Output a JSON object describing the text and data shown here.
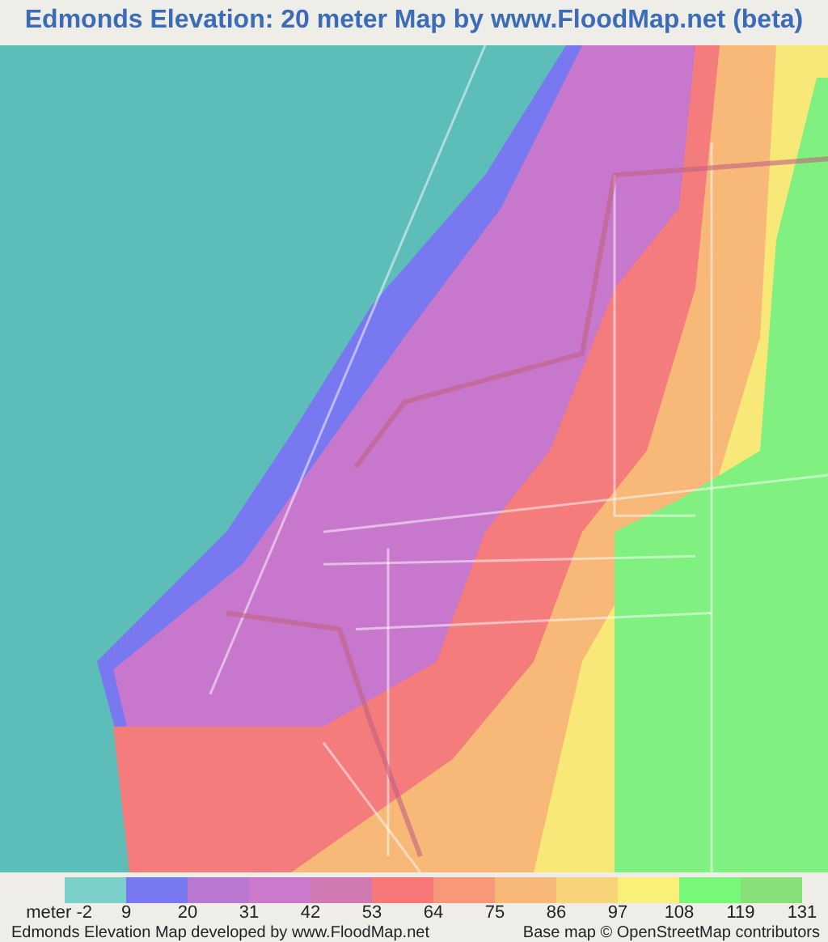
{
  "title": "Edmonds Elevation: 20 meter Map by www.FloodMap.net (beta)",
  "legend": {
    "unit": "meter",
    "items": [
      {
        "label": "-2",
        "color": "#7acfc8"
      },
      {
        "label": "9",
        "color": "#7878f0"
      },
      {
        "label": "20",
        "color": "#b878d0"
      },
      {
        "label": "31",
        "color": "#cc7acc"
      },
      {
        "label": "42",
        "color": "#d078b0"
      },
      {
        "label": "53",
        "color": "#f87878"
      },
      {
        "label": "64",
        "color": "#f89878"
      },
      {
        "label": "75",
        "color": "#f8b878"
      },
      {
        "label": "86",
        "color": "#f8d478"
      },
      {
        "label": "97",
        "color": "#f8f078"
      },
      {
        "label": "108",
        "color": "#78f878"
      },
      {
        "label": "119",
        "color": "#88e078"
      }
    ],
    "last_label": "131"
  },
  "footer": {
    "left": "Edmonds Elevation Map developed by www.FloodMap.net",
    "right": "Base map © OpenStreetMap contributors"
  }
}
